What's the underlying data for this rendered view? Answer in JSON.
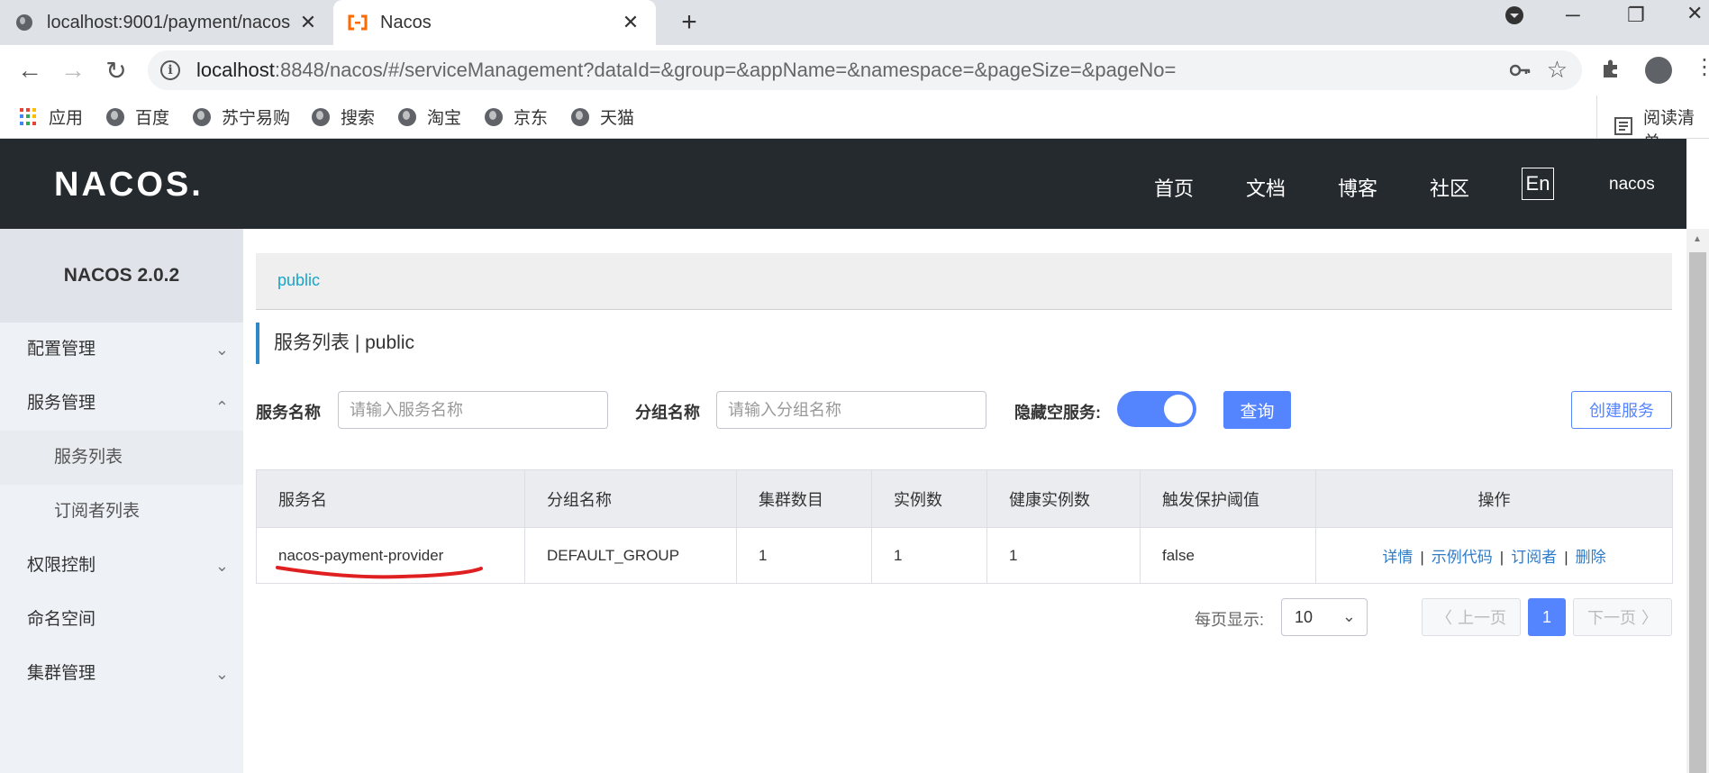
{
  "browser": {
    "tabs": [
      {
        "title": "localhost:9001/payment/nacos",
        "close": "✕"
      },
      {
        "title": "Nacos",
        "close": "✕"
      }
    ],
    "new_tab": "+",
    "url_host": "localhost",
    "url_rest": ":8848/nacos/#/serviceManagement?dataId=&group=&appName=&namespace=&pageSize=&pageNo=",
    "bookmarks": [
      "应用",
      "百度",
      "苏宁易购",
      "搜索",
      "淘宝",
      "京东",
      "天猫"
    ],
    "reading_list": "阅读清单"
  },
  "header": {
    "logo": "NACOS.",
    "nav": [
      "首页",
      "文档",
      "博客",
      "社区"
    ],
    "lang": "En",
    "user": "nacos"
  },
  "sidebar": {
    "title": "NACOS 2.0.2",
    "items": [
      {
        "label": "配置管理",
        "chevron": "⌄"
      },
      {
        "label": "服务管理",
        "chevron": "⌃"
      },
      {
        "label": "服务列表"
      },
      {
        "label": "订阅者列表"
      },
      {
        "label": "权限控制",
        "chevron": "⌄"
      },
      {
        "label": "命名空间"
      },
      {
        "label": "集群管理",
        "chevron": "⌄"
      }
    ]
  },
  "namespace_bar": "public",
  "page_title": "服务列表  |  public",
  "filters": {
    "service_name_label": "服务名称",
    "service_name_placeholder": "请输入服务名称",
    "group_name_label": "分组名称",
    "group_name_placeholder": "请输入分组名称",
    "hide_empty_label": "隐藏空服务:",
    "hide_empty_on": true,
    "query_button": "查询",
    "create_button": "创建服务"
  },
  "table": {
    "headers": [
      "服务名",
      "分组名称",
      "集群数目",
      "实例数",
      "健康实例数",
      "触发保护阈值",
      "操作"
    ],
    "rows": [
      {
        "service": "nacos-payment-provider",
        "group": "DEFAULT_GROUP",
        "clusters": "1",
        "instances": "1",
        "healthy": "1",
        "threshold": "false",
        "ops": [
          "详情",
          "示例代码",
          "订阅者",
          "删除"
        ]
      }
    ]
  },
  "pagination": {
    "page_size_label": "每页显示:",
    "page_size": "10",
    "prev": "上一页",
    "next": "下一页",
    "current": "1"
  },
  "colors": {
    "header_bg": "#252a2f",
    "primary": "#5584ff",
    "link": "#2e7bc8",
    "annotation": "#e02020"
  }
}
